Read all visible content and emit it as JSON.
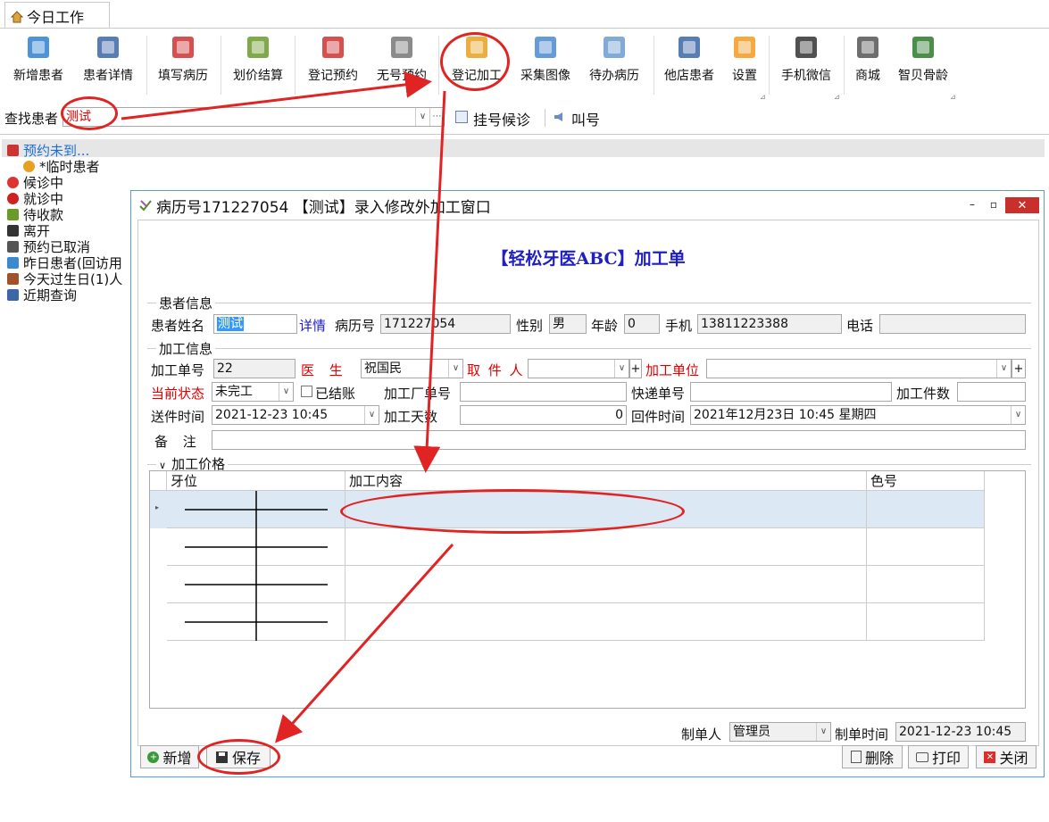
{
  "tab": {
    "title": "今日工作"
  },
  "toolbar": {
    "buttons": [
      {
        "id": "add_patient",
        "label": "新增患者",
        "icon": "add-person-icon"
      },
      {
        "id": "patient_detail",
        "label": "患者详情",
        "icon": "contact-card-icon"
      },
      {
        "id": "fill_record",
        "label": "填写病历",
        "icon": "medical-record-icon"
      },
      {
        "id": "pricing",
        "label": "划价结算",
        "icon": "yen-icon"
      },
      {
        "id": "appointment",
        "label": "登记预约",
        "icon": "calendar-icon"
      },
      {
        "id": "no_appointment",
        "label": "无号预约",
        "icon": "calendar-grid-icon"
      },
      {
        "id": "register_processing",
        "label": "登记加工",
        "icon": "cubes-icon"
      },
      {
        "id": "capture_image",
        "label": "采集图像",
        "icon": "picture-icon"
      },
      {
        "id": "pending_records",
        "label": "待办病历",
        "icon": "clipboard-check-icon"
      },
      {
        "id": "other_store",
        "label": "他店患者",
        "icon": "people-icon"
      },
      {
        "id": "settings",
        "label": "设置",
        "icon": "rss-icon"
      },
      {
        "id": "mobile_wechat",
        "label": "手机微信",
        "icon": "phone-icon"
      },
      {
        "id": "mall",
        "label": "商城",
        "icon": "cart-icon"
      },
      {
        "id": "bone_age",
        "label": "智贝骨龄",
        "icon": "antenna-icon"
      }
    ]
  },
  "search": {
    "label": "查找患者",
    "value": "测试",
    "queue_label": "挂号候诊",
    "call_label": "叫号"
  },
  "tree": [
    {
      "label": "预约未到...",
      "icon": "appointment-icon"
    },
    {
      "label": "*临时患者",
      "icon": "smile-icon"
    },
    {
      "label": "候诊中",
      "icon": "waiting-icon"
    },
    {
      "label": "就诊中",
      "icon": "treating-icon"
    },
    {
      "label": "待收款",
      "icon": "money-icon"
    },
    {
      "label": "离开",
      "icon": "walking-icon"
    },
    {
      "label": "预约已取消",
      "icon": "calendar-cancel-icon"
    },
    {
      "label": "昨日患者(回访用",
      "icon": "refresh-icon"
    },
    {
      "label": "今天过生日(1)人",
      "icon": "cake-icon"
    },
    {
      "label": "近期查询",
      "icon": "search-icon"
    }
  ],
  "dialog": {
    "title": "病历号171227054 【测试】录入修改外加工窗口",
    "heading": "【轻松牙医ABC】加工单",
    "patient_section": "患者信息",
    "patient_name_label": "患者姓名",
    "patient_name": "测试",
    "detail_link": "详情",
    "record_no_label": "病历号",
    "record_no": "171227054",
    "gender_label": "性别",
    "gender": "男",
    "age_label": "年龄",
    "age": "0",
    "mobile_label": "手机",
    "mobile": "13811223388",
    "phone_label": "电话",
    "phone": "",
    "process_section": "加工信息",
    "order_no_label": "加工单号",
    "order_no": "22",
    "doctor_label": "医 生",
    "doctor": "祝国民",
    "pickup_label": "取 件 人",
    "pickup": "",
    "unit_label": "加工单位",
    "unit": "",
    "status_label": "当前状态",
    "status": "未完工",
    "settled_label": "已结账",
    "factory_no_label": "加工厂单号",
    "factory_no": "",
    "express_label": "快递单号",
    "express": "",
    "count_label": "加工件数",
    "count": "",
    "send_time_label": "送件时间",
    "send_time": "2021-12-23  10:45",
    "days_label": "加工天数",
    "days": "0",
    "return_time_label": "回件时间",
    "return_time": "2021年12月23日  10:45  星期四",
    "remark_label": "备  注",
    "remark": "",
    "price_section": "加工价格",
    "columns": [
      "牙位",
      "加工内容",
      "色号"
    ],
    "maker_label": "制单人",
    "maker": "管理员",
    "make_time_label": "制单时间",
    "make_time": "2021-12-23  10:45",
    "btn_new": "新增",
    "btn_save": "保存",
    "btn_delete": "删除",
    "btn_print": "打印",
    "btn_close": "关闭"
  },
  "colors": {
    "annotation": "#e02424",
    "heading": "#1f1fc2",
    "required": "#e00000",
    "dialog_border": "#5b9bd5"
  }
}
